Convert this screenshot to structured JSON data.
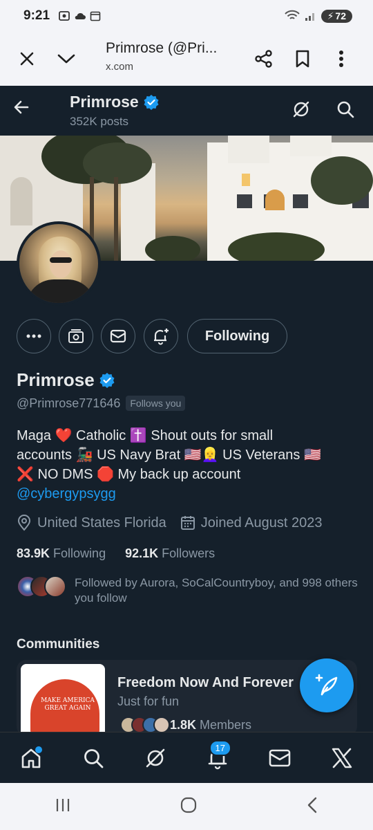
{
  "status_bar": {
    "time": "9:21",
    "battery": "72"
  },
  "browser": {
    "title": "Primrose (@Pri...",
    "url": "x.com"
  },
  "header": {
    "name": "Primrose",
    "posts": "352K posts"
  },
  "profile": {
    "name": "Primrose",
    "handle": "@Primrose771646",
    "follows_you": "Follows you",
    "following_button": "Following",
    "bio_line1": "Maga ❤️ Catholic ✝️ Shout outs for small",
    "bio_line2": "accounts 🚂 US Navy Brat 🇺🇸👱‍♀️ US Veterans 🇺🇸",
    "bio_line3": "❌ NO DMS 🛑 My back up account",
    "bio_link": "@cybergypsygg",
    "location": "United States Florida",
    "joined": "Joined August 2023",
    "following_count": "83.9K",
    "following_label": "Following",
    "followers_count": "92.1K",
    "followers_label": "Followers",
    "followed_by": "Followed by Aurora, SoCalCountryboy, and 998 others you follow"
  },
  "communities": {
    "title": "Communities",
    "card": {
      "name": "Freedom Now And Forever",
      "subtitle": "Just for fun",
      "members_count": "1.8K",
      "members_label": "Members",
      "cap_text": "MAKE AMERICA GREAT AGAIN"
    }
  },
  "bottom_nav": {
    "notification_count": "17"
  },
  "colors": {
    "accent": "#1d9bf0",
    "background": "#15202b",
    "secondary_text": "#8b98a5"
  },
  "icons": [
    "close-icon",
    "chevron-down-icon",
    "share-icon",
    "bookmark-icon",
    "more-vert-icon",
    "back-arrow-icon",
    "verified-icon",
    "grok-icon",
    "search-icon",
    "more-horiz-icon",
    "subscribe-icon",
    "mail-icon",
    "notification-add-icon",
    "location-icon",
    "calendar-icon",
    "compose-icon",
    "home-icon",
    "bell-icon",
    "x-logo-icon"
  ]
}
